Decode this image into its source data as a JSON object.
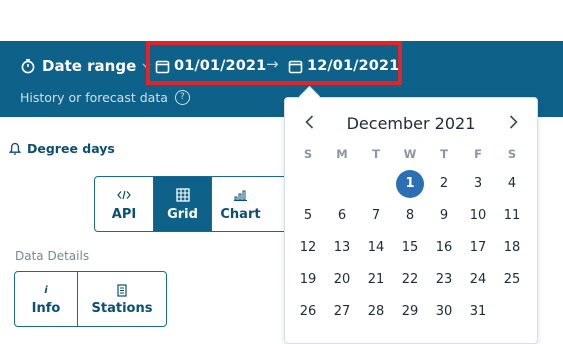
{
  "header": {
    "date_range_label": "Date range",
    "start_date": "01/01/2021",
    "arrow": "→",
    "end_date": "12/01/2021",
    "subtitle": "History or forecast data",
    "help_symbol": "?"
  },
  "section": {
    "degree_days_label": "Degree days"
  },
  "views": [
    {
      "label": "API",
      "icon": "code-icon",
      "active": false
    },
    {
      "label": "Grid",
      "icon": "grid-icon",
      "active": true
    },
    {
      "label": "Chart",
      "icon": "bar-chart-icon",
      "active": false
    }
  ],
  "data_details": {
    "title": "Data Details",
    "buttons": [
      {
        "label": "Info",
        "icon": "info-icon",
        "glyph": "i"
      },
      {
        "label": "Stations",
        "icon": "station-icon"
      }
    ]
  },
  "calendar": {
    "month_label": "December 2021",
    "weekdays": [
      "S",
      "M",
      "T",
      "W",
      "T",
      "F",
      "S"
    ],
    "first_weekday_index": 3,
    "days_in_month": 31,
    "selected_day": 1
  },
  "colors": {
    "header_bg": "#0e6189",
    "highlight_box": "#e1232a",
    "selected_day": "#2b6fb5",
    "accent_text": "#0b4f72"
  }
}
